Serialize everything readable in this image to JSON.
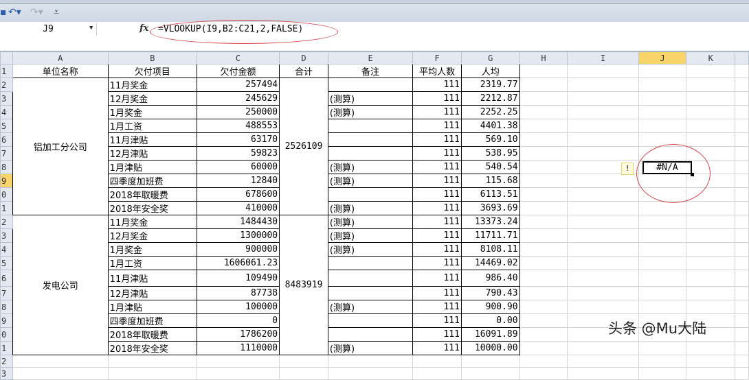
{
  "formula_bar": {
    "name_box": "J9",
    "fx": "fx",
    "formula": "=VLOOKUP(I9,B2:C21,2,FALSE)"
  },
  "columns": [
    "A",
    "B",
    "C",
    "D",
    "E",
    "F",
    "G",
    "H",
    "I",
    "J",
    "K"
  ],
  "selected_column": "J",
  "selected_row": 9,
  "header_row": [
    "单位名称",
    "欠付项目",
    "欠付金额",
    "合计",
    "备注",
    "平均人数",
    "人均"
  ],
  "groups": [
    {
      "unit": "铝加工分公司",
      "total": "2526109",
      "rows": [
        [
          "11月奖金",
          "257494",
          "",
          "111",
          "2319.77"
        ],
        [
          "12月奖金",
          "245629",
          "(测算)",
          "111",
          "2212.87"
        ],
        [
          "1月奖金",
          "250000",
          "(测算)",
          "111",
          "2252.25"
        ],
        [
          "1月工资",
          "488553",
          "",
          "111",
          "4401.38"
        ],
        [
          "11月津贴",
          "63170",
          "",
          "111",
          "569.10"
        ],
        [
          "12月津贴",
          "59823",
          "",
          "111",
          "538.95"
        ],
        [
          "1月津贴",
          "60000",
          "(测算)",
          "111",
          "540.54"
        ],
        [
          "四季度加班费",
          "12840",
          "(测算)",
          "111",
          "115.68"
        ],
        [
          "2018年取暖费",
          "678600",
          "",
          "111",
          "6113.51"
        ],
        [
          "2018年安全奖",
          "410000",
          "(测算)",
          "111",
          "3693.69"
        ]
      ]
    },
    {
      "unit": "发电公司",
      "total": "8483919",
      "rows": [
        [
          "11月奖金",
          "1484430",
          "(测算)",
          "111",
          "13373.24"
        ],
        [
          "12月奖金",
          "1300000",
          "(测算)",
          "111",
          "11711.71"
        ],
        [
          "1月奖金",
          "900000",
          "(测算)",
          "111",
          "8108.11"
        ],
        [
          "1月工资",
          "1606061.23",
          "",
          "111",
          "14469.02"
        ],
        [
          "11月津贴",
          "109490",
          "",
          "111",
          "986.40"
        ],
        [
          "12月津贴",
          "87738",
          "",
          "111",
          "790.43"
        ],
        [
          "1月津贴",
          "100000",
          "(测算)",
          "111",
          "900.90"
        ],
        [
          "四季度加班费",
          "0",
          "",
          "111",
          "0.00"
        ],
        [
          "2018年取暖费",
          "1786200",
          "",
          "111",
          "16091.89"
        ],
        [
          "2018年安全奖",
          "1110000",
          "(测算)",
          "111",
          "10000.00"
        ]
      ]
    }
  ],
  "active_cell_value": "#N/A",
  "error_icon": "!",
  "watermark": "头条 @Mu大陆"
}
